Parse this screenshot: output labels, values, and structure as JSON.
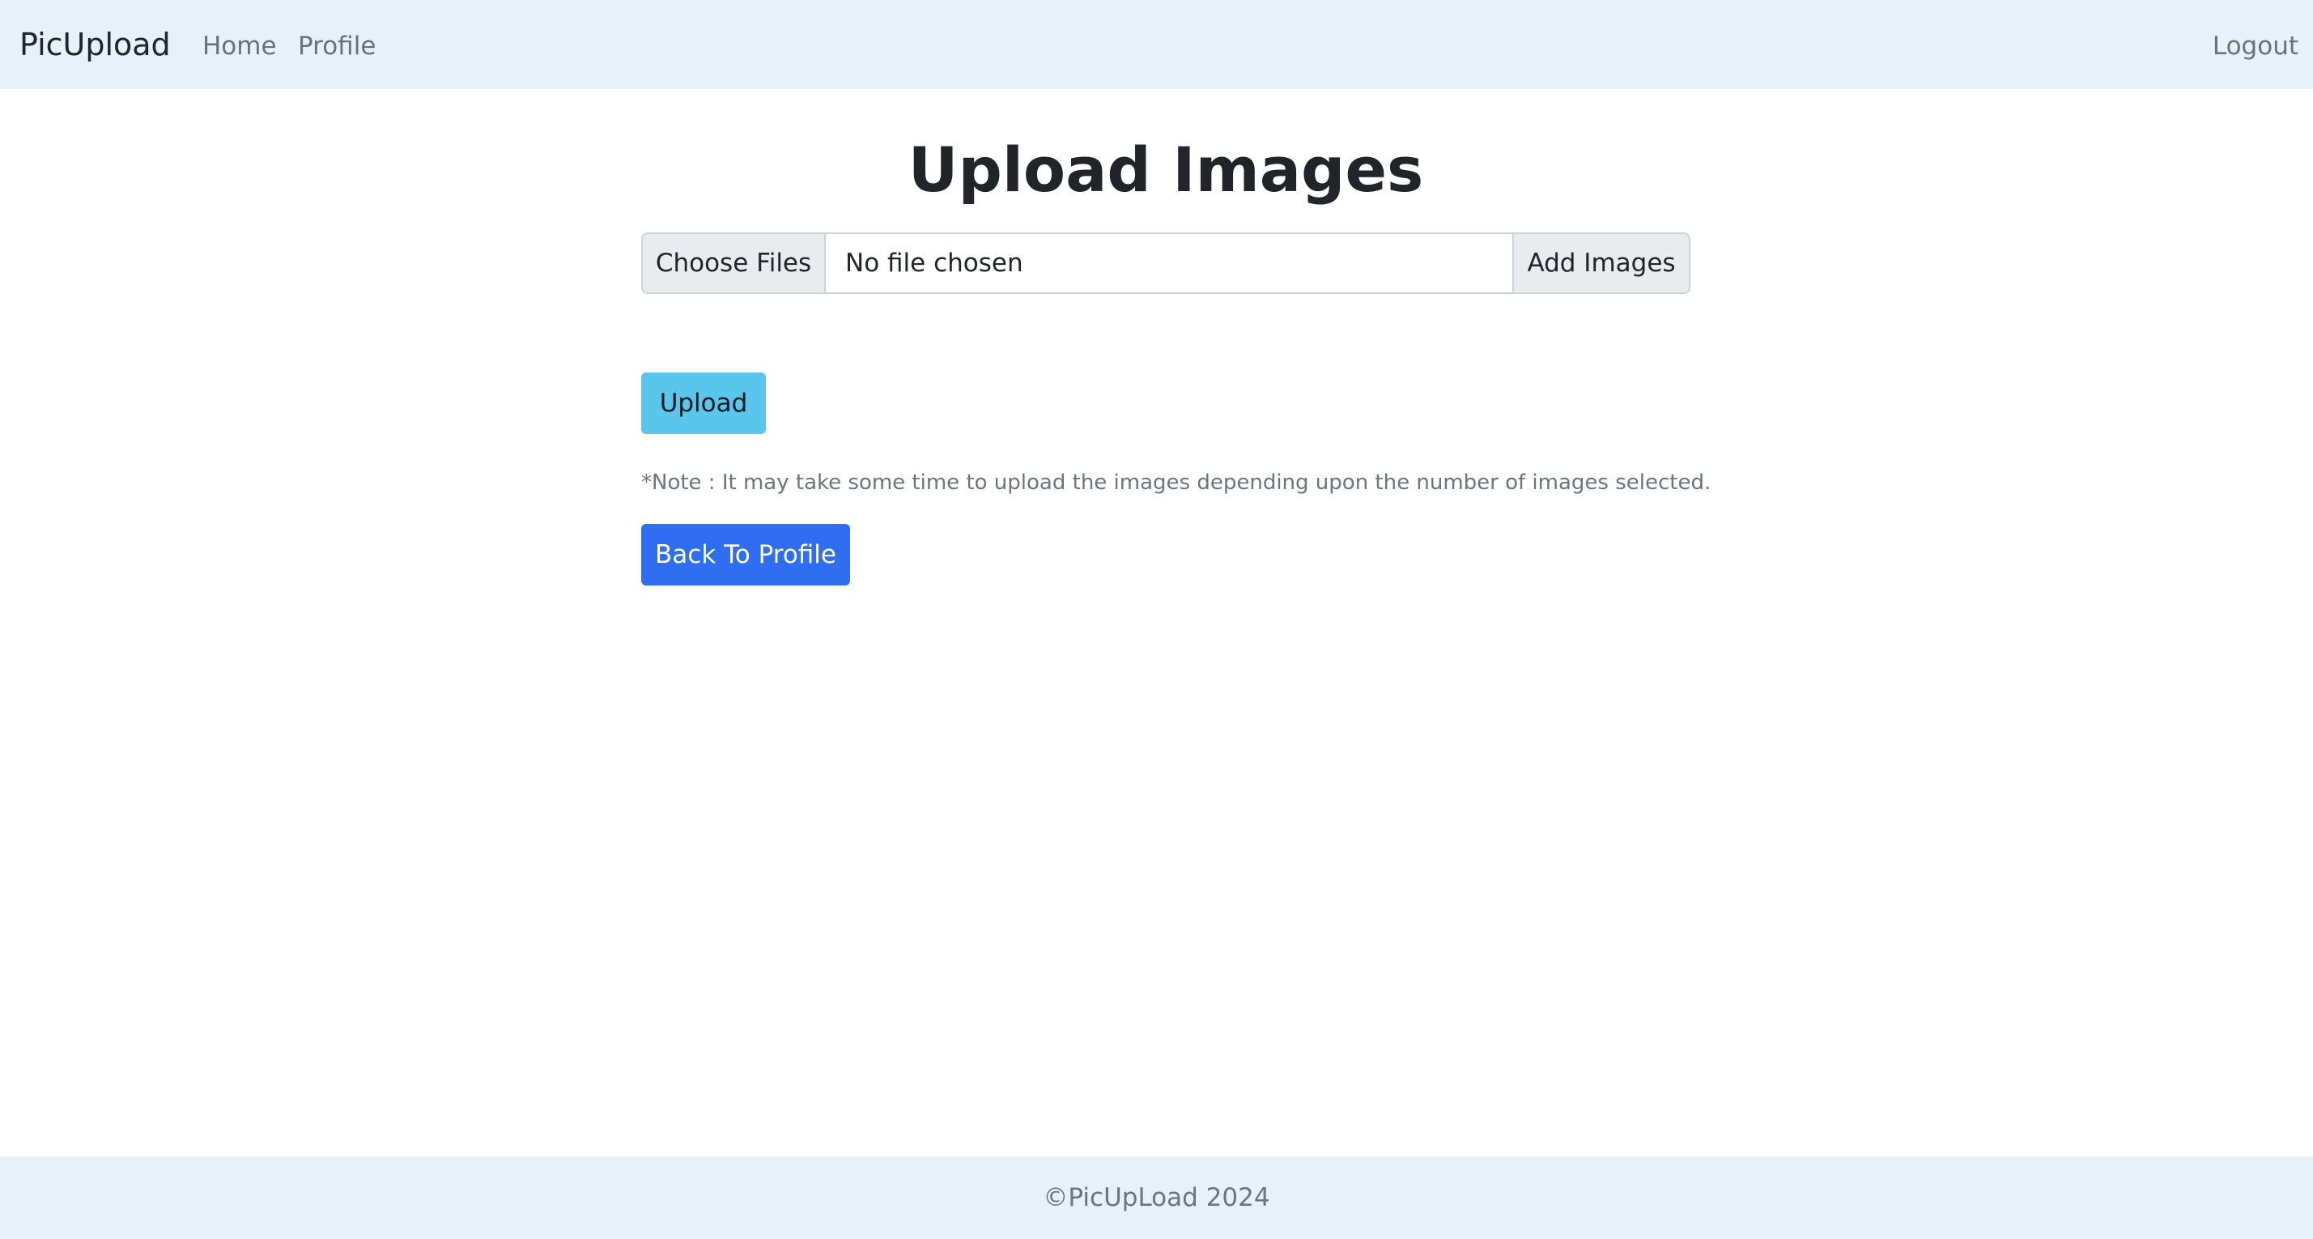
{
  "navbar": {
    "brand": "PicUpload",
    "links": [
      {
        "label": "Home"
      },
      {
        "label": "Profile"
      }
    ],
    "logout_label": "Logout"
  },
  "main": {
    "title": "Upload Images",
    "file_input": {
      "choose_label": "Choose Files",
      "status": "No file chosen",
      "add_label": "Add Images"
    },
    "upload_label": "Upload",
    "note": "*Note : It may take some time to upload the images depending upon the number of images selected.",
    "back_label": "Back To Profile"
  },
  "footer": {
    "text": "©PicUpLoad 2024"
  },
  "colors": {
    "navbar_bg": "#e7f1fa",
    "upload_button": "#5bc6eb",
    "back_button": "#2f6ef0"
  }
}
